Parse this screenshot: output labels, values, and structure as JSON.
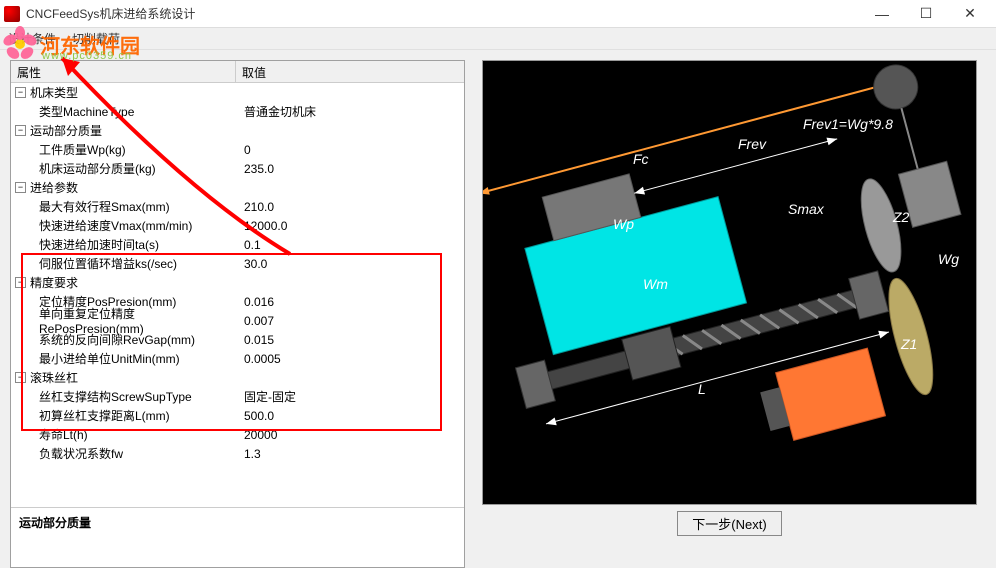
{
  "window": {
    "title": "CNCFeedSys机床进给系统设计",
    "min": "—",
    "max": "☐",
    "close": "✕"
  },
  "menu": {
    "designConditions": "设计条件",
    "cuttingLoad": "切削载荷"
  },
  "watermark": {
    "name": "河东软件园",
    "url": "www.pc0359.cn"
  },
  "propHeader": {
    "attr": "属性",
    "value": "取值"
  },
  "groups": {
    "machineType": "机床类型",
    "motionMass": "运动部分质量",
    "feedParams": "进给参数",
    "precision": "精度要求",
    "ballScrew": "滚珠丝杠"
  },
  "rows": {
    "machineTypeLabel": "类型MachineType",
    "machineTypeVal": "普通金切机床",
    "wpLabel": "工件质量Wp(kg)",
    "wpVal": "0",
    "massLabel": "机床运动部分质量(kg)",
    "massVal": "235.0",
    "smaxLabel": "最大有效行程Smax(mm)",
    "smaxVal": "210.0",
    "vmaxLabel": "快速进给速度Vmax(mm/min)",
    "vmaxVal": "12000.0",
    "taLabel": "快速进给加速时间ta(s)",
    "taVal": "0.1",
    "ksLabel": "伺服位置循环增益ks(/sec)",
    "ksVal": "30.0",
    "posLabel": "定位精度PosPresion(mm)",
    "posVal": "0.016",
    "reposLabel": "单向重复定位精度RePosPresion(mm)",
    "reposVal": "0.007",
    "revgapLabel": "系统的反向间隙RevGap(mm)",
    "revgapVal": "0.015",
    "unitminLabel": "最小进给单位UnitMin(mm)",
    "unitminVal": "0.0005",
    "screwLabel": "丝杠支撑结构ScrewSupType",
    "screwVal": "固定-固定",
    "LLabel": "初算丝杠支撑距离L(mm)",
    "LVal": "500.0",
    "ltLabel": "寿命Lt(h)",
    "ltVal": "20000",
    "fwLabel": "负载状况系数fw",
    "fwVal": "1.3"
  },
  "bottomLabel": "运动部分质量",
  "nextBtn": "下一步(Next)",
  "diagram": {
    "Fc": "Fc",
    "Frev": "Frev",
    "Frev1": "Frev1=Wg*9.8",
    "Wp": "Wp",
    "Wm": "Wm",
    "Wg": "Wg",
    "Smax": "Smax",
    "L": "L",
    "Z1": "Z1",
    "Z2": "Z2"
  }
}
